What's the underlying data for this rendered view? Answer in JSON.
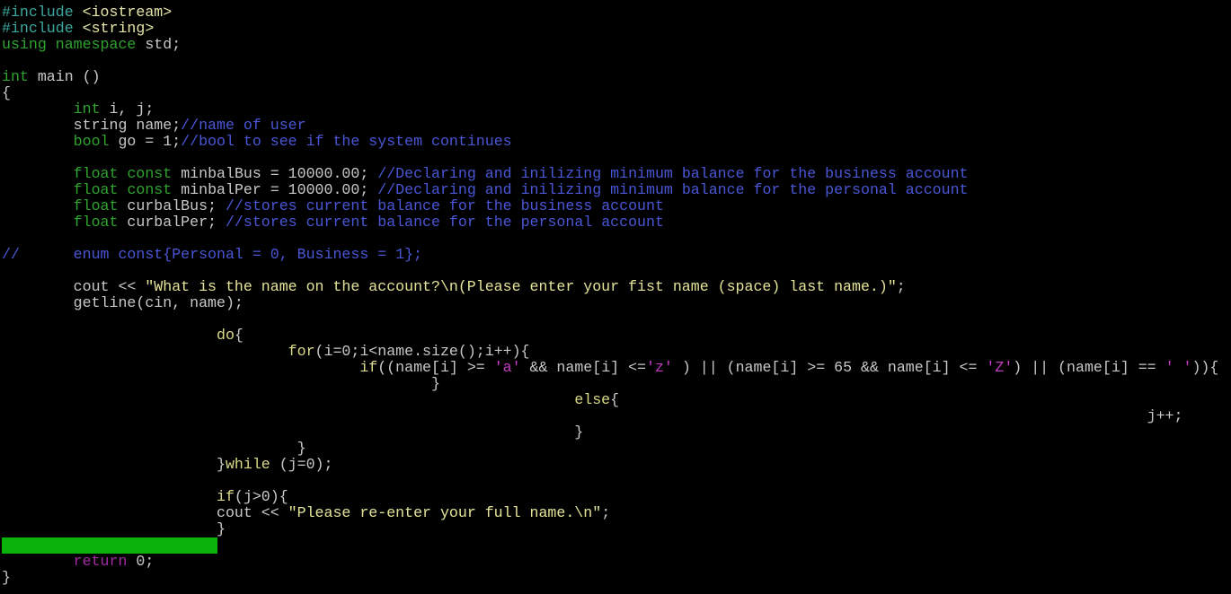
{
  "editor": {
    "highlight_color": "#0ab20a",
    "highlighted_line": 34,
    "lines": [
      {
        "row": 1,
        "tokens": [
          {
            "c": "preproc",
            "t": "#include"
          },
          {
            "c": "default",
            "t": " "
          },
          {
            "c": "include",
            "t": "<iostream>"
          }
        ]
      },
      {
        "row": 2,
        "tokens": [
          {
            "c": "preproc",
            "t": "#include"
          },
          {
            "c": "default",
            "t": " "
          },
          {
            "c": "include",
            "t": "<string>"
          }
        ]
      },
      {
        "row": 3,
        "tokens": [
          {
            "c": "type",
            "t": "using"
          },
          {
            "c": "default",
            "t": " "
          },
          {
            "c": "type",
            "t": "namespace"
          },
          {
            "c": "default",
            "t": " std;"
          }
        ]
      },
      {
        "row": 4,
        "tokens": []
      },
      {
        "row": 5,
        "tokens": [
          {
            "c": "type",
            "t": "int"
          },
          {
            "c": "default",
            "t": " main ()"
          }
        ]
      },
      {
        "row": 6,
        "tokens": [
          {
            "c": "default",
            "t": "{"
          }
        ]
      },
      {
        "row": 7,
        "tokens": [
          {
            "c": "default",
            "t": "        "
          },
          {
            "c": "type",
            "t": "int"
          },
          {
            "c": "default",
            "t": " i, j;"
          }
        ]
      },
      {
        "row": 8,
        "tokens": [
          {
            "c": "default",
            "t": "        string name;"
          },
          {
            "c": "comment",
            "t": "//name of user"
          }
        ]
      },
      {
        "row": 9,
        "tokens": [
          {
            "c": "default",
            "t": "        "
          },
          {
            "c": "type",
            "t": "bool"
          },
          {
            "c": "default",
            "t": " go = 1;"
          },
          {
            "c": "comment",
            "t": "//bool to see if the system continues"
          }
        ]
      },
      {
        "row": 10,
        "tokens": []
      },
      {
        "row": 11,
        "tokens": [
          {
            "c": "default",
            "t": "        "
          },
          {
            "c": "type",
            "t": "float"
          },
          {
            "c": "default",
            "t": " "
          },
          {
            "c": "type",
            "t": "const"
          },
          {
            "c": "default",
            "t": " minbalBus = 10000.00; "
          },
          {
            "c": "comment",
            "t": "//Declaring and inilizing minimum balance for the business account"
          }
        ]
      },
      {
        "row": 12,
        "tokens": [
          {
            "c": "default",
            "t": "        "
          },
          {
            "c": "type",
            "t": "float"
          },
          {
            "c": "default",
            "t": " "
          },
          {
            "c": "type",
            "t": "const"
          },
          {
            "c": "default",
            "t": " minbalPer = 10000.00; "
          },
          {
            "c": "comment",
            "t": "//Declaring and inilizing minimum balance for the personal account"
          }
        ]
      },
      {
        "row": 13,
        "tokens": [
          {
            "c": "default",
            "t": "        "
          },
          {
            "c": "type",
            "t": "float"
          },
          {
            "c": "default",
            "t": " curbalBus; "
          },
          {
            "c": "comment",
            "t": "//stores current balance for the business account"
          }
        ]
      },
      {
        "row": 14,
        "tokens": [
          {
            "c": "default",
            "t": "        "
          },
          {
            "c": "type",
            "t": "float"
          },
          {
            "c": "default",
            "t": " curbalPer; "
          },
          {
            "c": "comment",
            "t": "//stores current balance for the personal account"
          }
        ]
      },
      {
        "row": 15,
        "tokens": []
      },
      {
        "row": 16,
        "tokens": [
          {
            "c": "comment",
            "t": "//      enum const{Personal = 0, Business = 1};"
          }
        ]
      },
      {
        "row": 17,
        "tokens": []
      },
      {
        "row": 18,
        "tokens": [
          {
            "c": "default",
            "t": "        cout << "
          },
          {
            "c": "string",
            "t": "\"What is the name on the account?\\n(Please enter your fist name (space) last name.)\""
          },
          {
            "c": "default",
            "t": ";"
          }
        ]
      },
      {
        "row": 19,
        "tokens": [
          {
            "c": "default",
            "t": "        getline(cin, name);"
          }
        ]
      },
      {
        "row": 20,
        "tokens": []
      },
      {
        "row": 21,
        "tokens": [
          {
            "c": "default",
            "t": "                        "
          },
          {
            "c": "statement",
            "t": "do"
          },
          {
            "c": "default",
            "t": "{"
          }
        ]
      },
      {
        "row": 22,
        "tokens": [
          {
            "c": "default",
            "t": "                                "
          },
          {
            "c": "statement",
            "t": "for"
          },
          {
            "c": "default",
            "t": "(i=0;i<name.size();i++){"
          }
        ]
      },
      {
        "row": 23,
        "tokens": [
          {
            "c": "default",
            "t": "                                        "
          },
          {
            "c": "statement",
            "t": "if"
          },
          {
            "c": "default",
            "t": "((name[i] >= "
          },
          {
            "c": "char",
            "t": "'a'"
          },
          {
            "c": "default",
            "t": " && name[i] <="
          },
          {
            "c": "char",
            "t": "'z'"
          },
          {
            "c": "default",
            "t": " ) || (name[i] >= 65 && name[i] <= "
          },
          {
            "c": "char",
            "t": "'Z'"
          },
          {
            "c": "default",
            "t": ") || (name[i] == "
          },
          {
            "c": "char",
            "t": "' '"
          },
          {
            "c": "default",
            "t": ")){"
          }
        ]
      },
      {
        "row": 24,
        "tokens": [
          {
            "c": "default",
            "t": "                                                }"
          }
        ]
      },
      {
        "row": 25,
        "tokens": [
          {
            "c": "default",
            "t": "                                                                "
          },
          {
            "c": "statement",
            "t": "else"
          },
          {
            "c": "default",
            "t": "{"
          }
        ]
      },
      {
        "row": 26,
        "tokens": [
          {
            "c": "default",
            "t": "                                                                                                                                j++;"
          }
        ]
      },
      {
        "row": 27,
        "tokens": [
          {
            "c": "default",
            "t": "                                                                }"
          }
        ]
      },
      {
        "row": 28,
        "tokens": [
          {
            "c": "default",
            "t": "                                 }"
          }
        ]
      },
      {
        "row": 29,
        "tokens": [
          {
            "c": "default",
            "t": "                        }"
          },
          {
            "c": "statement",
            "t": "while"
          },
          {
            "c": "default",
            "t": " (j=0);"
          }
        ]
      },
      {
        "row": 30,
        "tokens": []
      },
      {
        "row": 31,
        "tokens": [
          {
            "c": "default",
            "t": "                        "
          },
          {
            "c": "statement",
            "t": "if"
          },
          {
            "c": "default",
            "t": "(j>0){"
          }
        ]
      },
      {
        "row": 32,
        "tokens": [
          {
            "c": "default",
            "t": "                        cout << "
          },
          {
            "c": "string",
            "t": "\"Please re-enter your full name.\\n\""
          },
          {
            "c": "default",
            "t": ";"
          }
        ]
      },
      {
        "row": 33,
        "tokens": [
          {
            "c": "default",
            "t": "                        }"
          }
        ]
      },
      {
        "row": 34,
        "tokens": []
      },
      {
        "row": 35,
        "tokens": [
          {
            "c": "default",
            "t": "        "
          },
          {
            "c": "return",
            "t": "return"
          },
          {
            "c": "default",
            "t": " 0;"
          }
        ]
      },
      {
        "row": 36,
        "tokens": [
          {
            "c": "default",
            "t": "}"
          }
        ]
      }
    ]
  }
}
